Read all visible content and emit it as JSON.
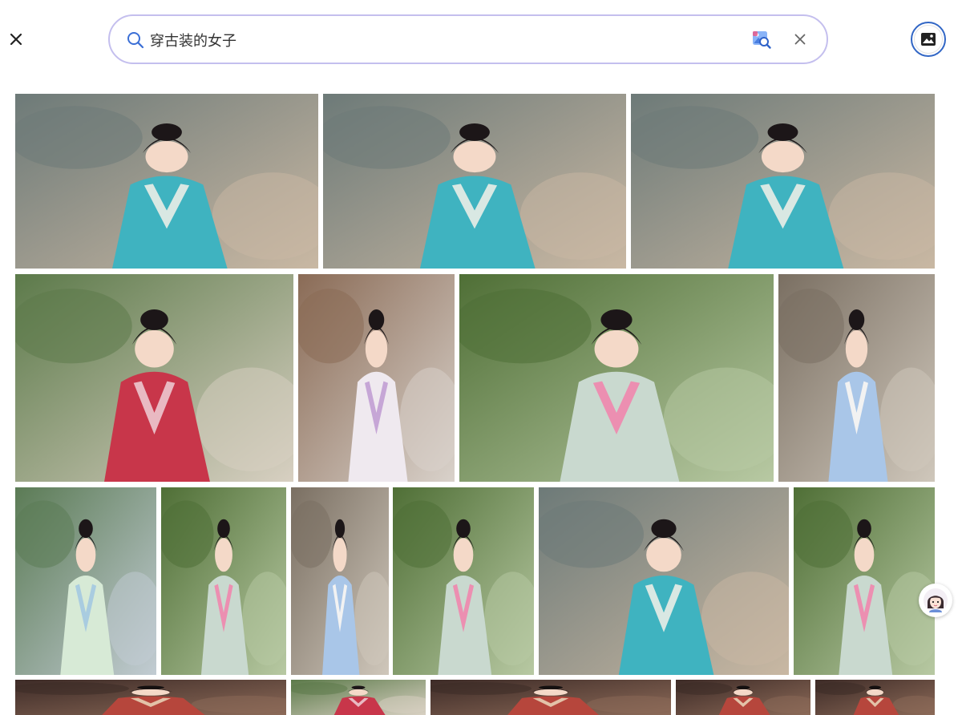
{
  "search": {
    "query": "穿古装的女子"
  },
  "icons": {
    "close": "close-icon",
    "search": "search-icon",
    "camera": "image-search-icon",
    "clear": "clear-icon",
    "upload": "image-upload-icon",
    "assistant": "assistant-avatar-icon"
  },
  "colors": {
    "search_border": "#c4bfee",
    "search_icon": "#3b6fd6",
    "upload_ring": "#3166c5",
    "background": "#ffffff"
  },
  "results": [
    {
      "theme": "teal"
    },
    {
      "theme": "teal"
    },
    {
      "theme": "teal"
    },
    {
      "theme": "red"
    },
    {
      "theme": "white"
    },
    {
      "theme": "green"
    },
    {
      "theme": "lightblue"
    },
    {
      "theme": "mixed"
    },
    {
      "theme": "green"
    },
    {
      "theme": "lightblue"
    },
    {
      "theme": "green"
    },
    {
      "theme": "teal"
    },
    {
      "theme": "green"
    },
    {
      "theme": "dark"
    },
    {
      "theme": "red"
    },
    {
      "theme": "dark"
    },
    {
      "theme": "dark"
    },
    {
      "theme": "dark"
    }
  ]
}
